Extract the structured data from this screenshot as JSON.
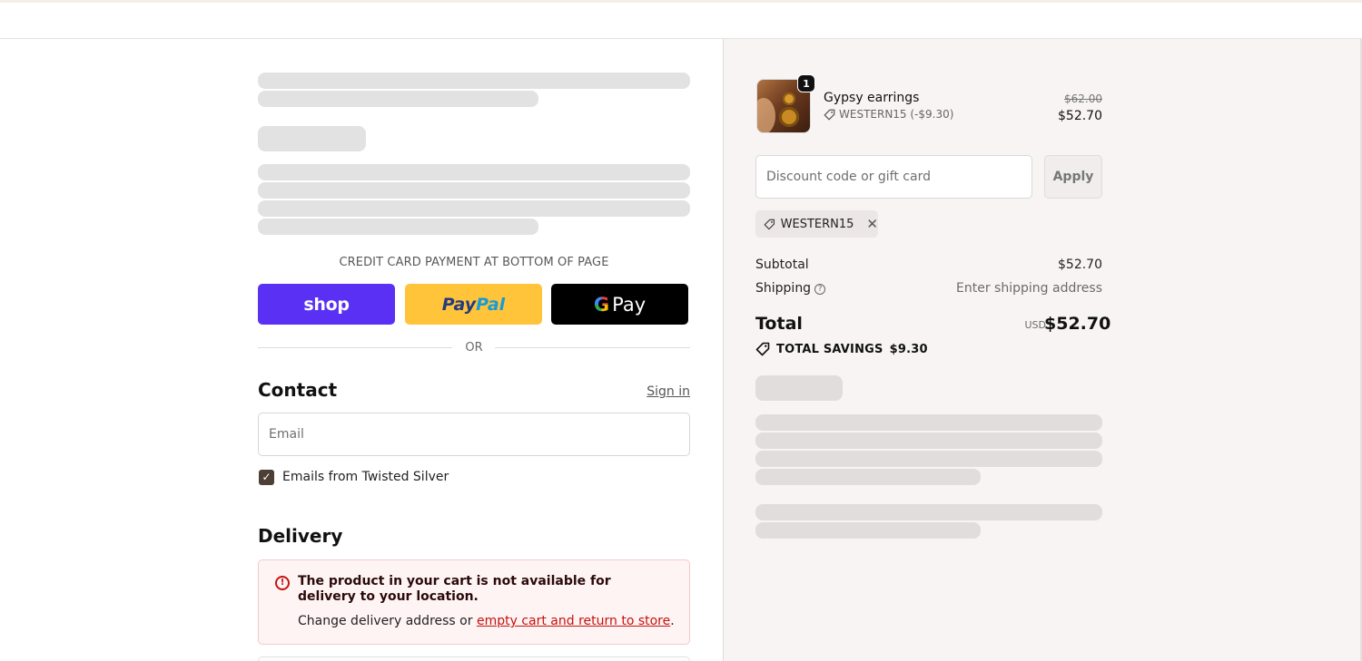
{
  "express": {
    "note": "CREDIT CARD PAYMENT AT BOTTOM OF PAGE",
    "shop_label": "shop",
    "paypal_part1": "Pay",
    "paypal_part2": "Pal",
    "gpay_g": "G",
    "gpay_label": "Pay",
    "or_label": "OR"
  },
  "contact": {
    "title": "Contact",
    "signin_label": "Sign in",
    "email_placeholder": "Email",
    "newsletter_checked": true,
    "newsletter_label": "Emails from Twisted Silver"
  },
  "delivery": {
    "title": "Delivery",
    "alert_title": "The product in your cart is not available for delivery to your location.",
    "alert_body_prefix": "Change delivery address or ",
    "alert_link": "empty cart and return to store",
    "alert_body_suffix": "."
  },
  "summary": {
    "item": {
      "quantity": "1",
      "name": "Gypsy earrings",
      "discount_line": "WESTERN15 (-$9.30)",
      "original_price": "$62.00",
      "price": "$52.70"
    },
    "discount_placeholder": "Discount code or gift card",
    "apply_label": "Apply",
    "applied_code": "WESTERN15",
    "subtotal_label": "Subtotal",
    "subtotal_value": "$52.70",
    "shipping_label": "Shipping",
    "shipping_value": "Enter shipping address",
    "total_label": "Total",
    "currency": "USD",
    "total_value": "$52.70",
    "savings_label": "TOTAL SAVINGS",
    "savings_value": "$9.30"
  }
}
